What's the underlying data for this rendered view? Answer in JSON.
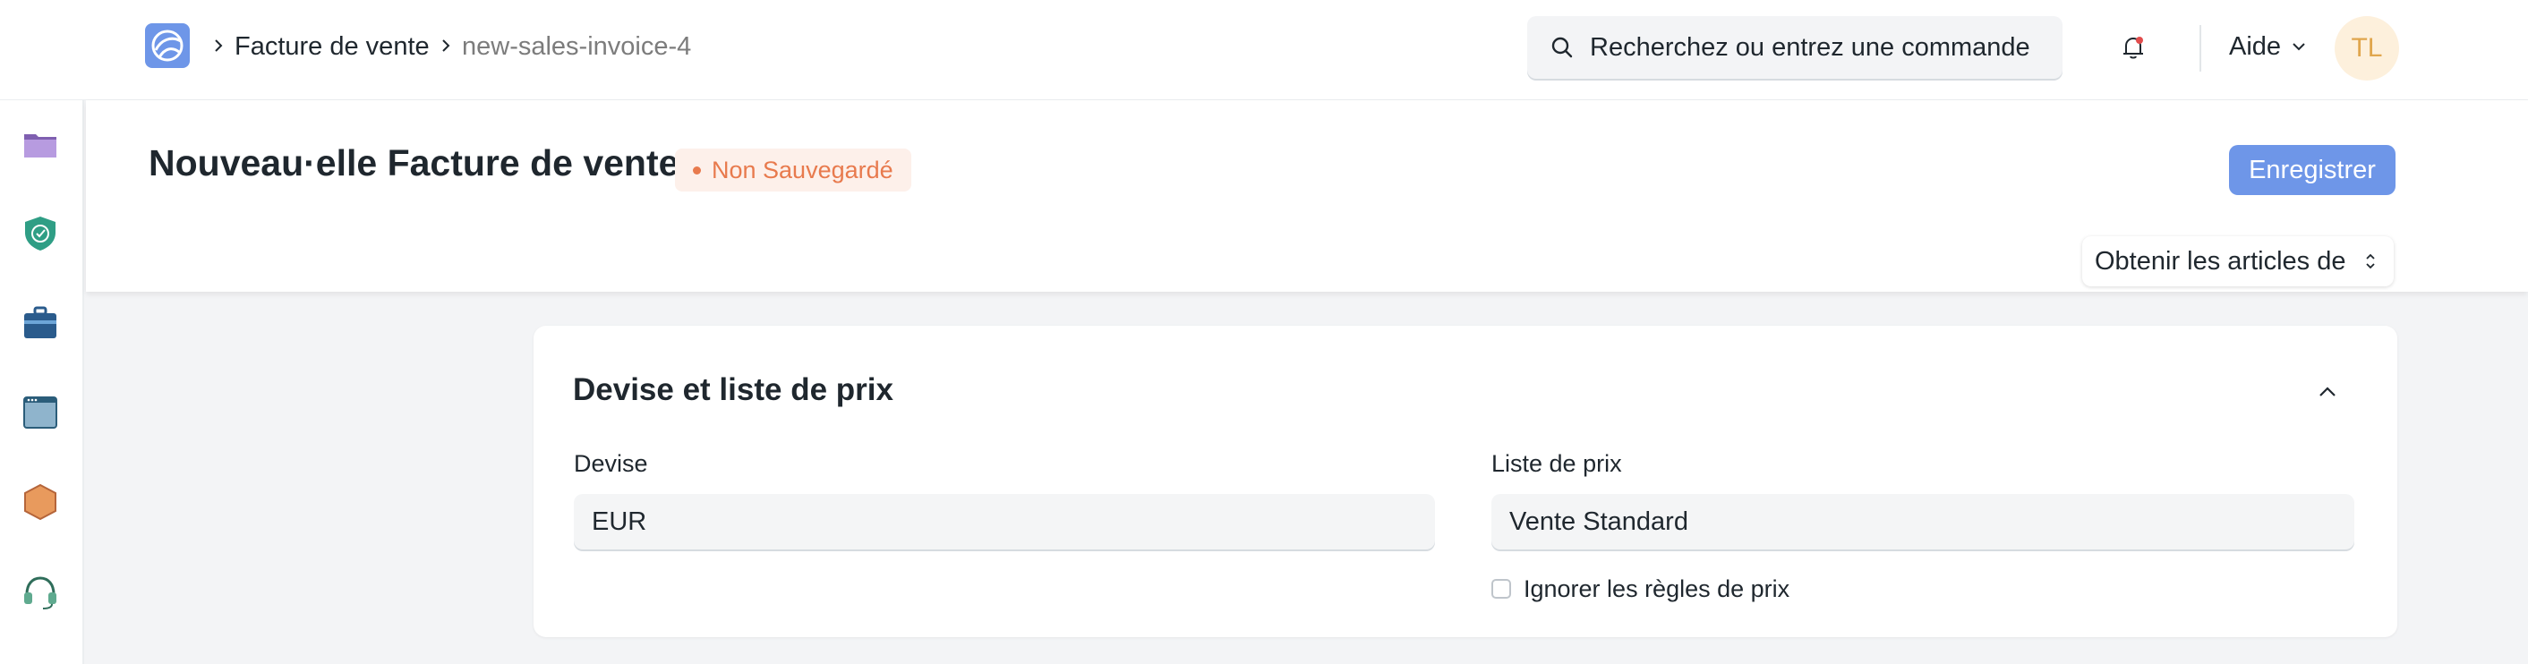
{
  "navbar": {
    "breadcrumbs": [
      "Facture de vente",
      "new-sales-invoice-4"
    ],
    "search_placeholder": "Recherchez ou entrez une commande",
    "help_label": "Aide",
    "avatar_initials": "TL"
  },
  "sidebar": {
    "icons": [
      "folder-icon",
      "shield-check-icon",
      "briefcase-icon",
      "window-icon",
      "hexagon-icon",
      "headset-icon"
    ]
  },
  "page": {
    "title": "Nouveau·elle Facture de vente",
    "status": "Non Sauvegardé",
    "save_label": "Enregistrer",
    "get_items_label": "Obtenir les articles de"
  },
  "section": {
    "title": "Devise et liste de prix",
    "currency_label": "Devise",
    "currency_value": "EUR",
    "price_list_label": "Liste de prix",
    "price_list_value": "Vente Standard",
    "ignore_pricing_rule_label": "Ignorer les règles de prix",
    "ignore_pricing_rule_checked": false
  },
  "colors": {
    "primary": "#6e96e8",
    "status_text": "#e87a4d",
    "status_bg": "#fdf0ea",
    "avatar_bg": "#fdf0dc",
    "avatar_text": "#e0a64d",
    "background": "#f3f4f6"
  }
}
